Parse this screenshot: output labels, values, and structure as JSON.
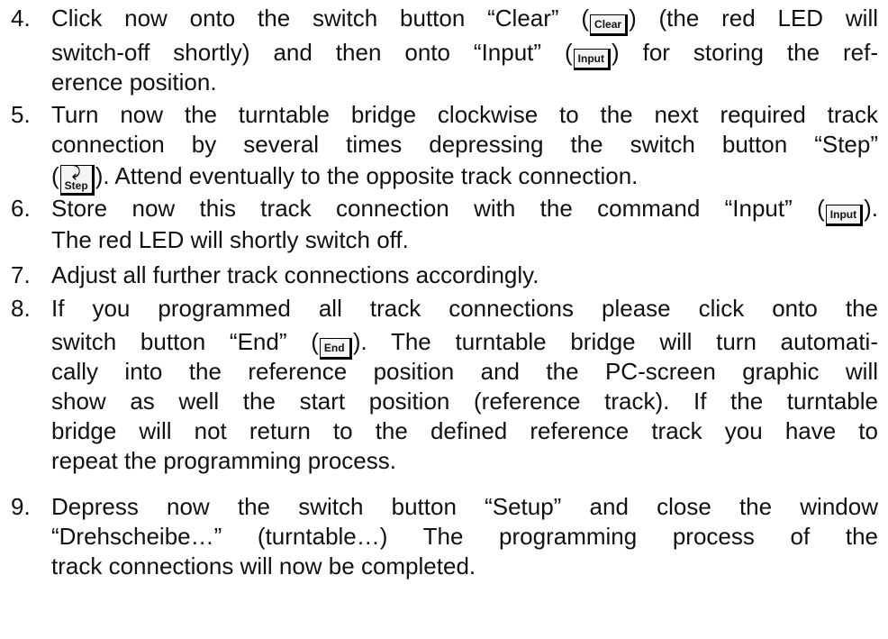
{
  "items": [
    {
      "number": "4.",
      "lines": [
        [
          "Click now onto the switch button “Clear” (",
          {
            "key": "Clear"
          },
          ") (the red LED will"
        ],
        [
          "switch-off shortly) and then onto “Input” (",
          {
            "key": "Input"
          },
          ") for storing the ref-"
        ],
        [
          "erence position."
        ]
      ]
    },
    {
      "number": "5.",
      "lines": [
        [
          "Turn now the turntable bridge clockwise to the next required track"
        ],
        [
          "connection by several times depressing the switch button “Step”"
        ],
        [
          "(",
          {
            "key": "Step",
            "icon": "⤸"
          },
          "). Attend eventually to the opposite track connection."
        ]
      ]
    },
    {
      "number": "6.",
      "lines": [
        [
          "Store now this track connection with the command “Input” (",
          {
            "key": "Input"
          },
          ")."
        ],
        [
          "The red LED will shortly switch off."
        ]
      ]
    },
    {
      "number": "7.",
      "lines": [
        [
          "Adjust all further track connections accordingly."
        ]
      ]
    },
    {
      "number": "8.",
      "lines": [
        [
          "If you programmed all track connections please click onto the"
        ],
        [
          "switch button “End” (",
          {
            "key": "End"
          },
          "). The turntable bridge will turn automati-"
        ],
        [
          "cally into the reference position and the PC-screen graphic will"
        ],
        [
          "show as well the start position (reference track). If the turntable"
        ],
        [
          "bridge will not return to the defined reference track you have to"
        ],
        [
          "repeat the programming process."
        ]
      ]
    },
    {
      "number": "9.",
      "lines": [
        [
          "Depress now the switch button “Setup” and close the window"
        ],
        [
          "“Drehscheibe…” (turntable…) The programming process of the"
        ],
        [
          "track connections will now be completed."
        ]
      ]
    }
  ]
}
